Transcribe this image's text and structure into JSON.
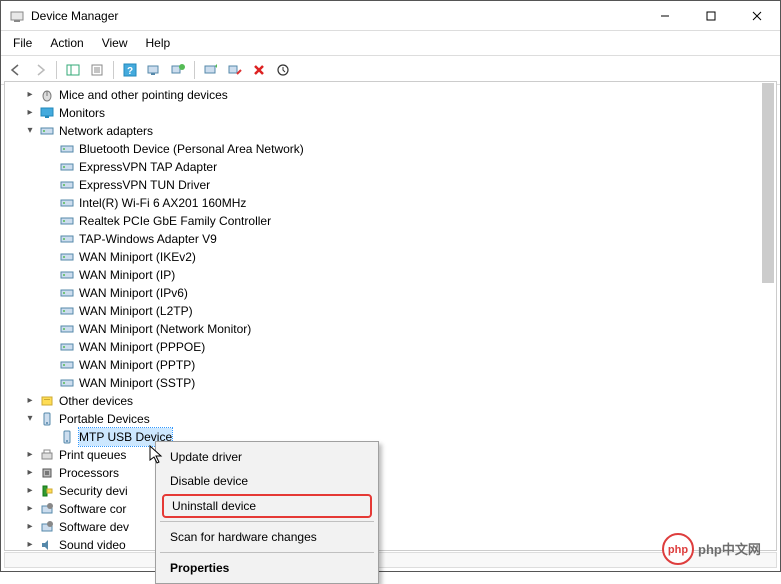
{
  "window": {
    "title": "Device Manager"
  },
  "menu": {
    "file": "File",
    "action": "Action",
    "view": "View",
    "help": "Help"
  },
  "tree": {
    "mice": "Mice and other pointing devices",
    "monitors": "Monitors",
    "network_adapters": "Network adapters",
    "na": {
      "bluetooth": "Bluetooth Device (Personal Area Network)",
      "evpn_tap": "ExpressVPN TAP Adapter",
      "evpn_tun": "ExpressVPN TUN Driver",
      "wifi": "Intel(R) Wi-Fi 6 AX201 160MHz",
      "realtek": "Realtek PCIe GbE Family Controller",
      "tap_windows": "TAP-Windows Adapter V9",
      "wan_ikev2": "WAN Miniport (IKEv2)",
      "wan_ip": "WAN Miniport (IP)",
      "wan_ipv6": "WAN Miniport (IPv6)",
      "wan_l2tp": "WAN Miniport (L2TP)",
      "wan_netmon": "WAN Miniport (Network Monitor)",
      "wan_pppoe": "WAN Miniport (PPPOE)",
      "wan_pptp": "WAN Miniport (PPTP)",
      "wan_sstp": "WAN Miniport (SSTP)"
    },
    "other_devices": "Other devices",
    "portable_devices": "Portable Devices",
    "mtp_usb": "MTP USB Device",
    "print_queues": "Print queues",
    "processors": "Processors",
    "security_devices": "Security devi",
    "software_components": "Software cor",
    "software_devices": "Software dev",
    "sound_video": "Sound  video"
  },
  "context_menu": {
    "update_driver": "Update driver",
    "disable_device": "Disable device",
    "uninstall_device": "Uninstall device",
    "scan_hardware": "Scan for hardware changes",
    "properties": "Properties"
  },
  "watermark": {
    "text": "php中文网"
  }
}
